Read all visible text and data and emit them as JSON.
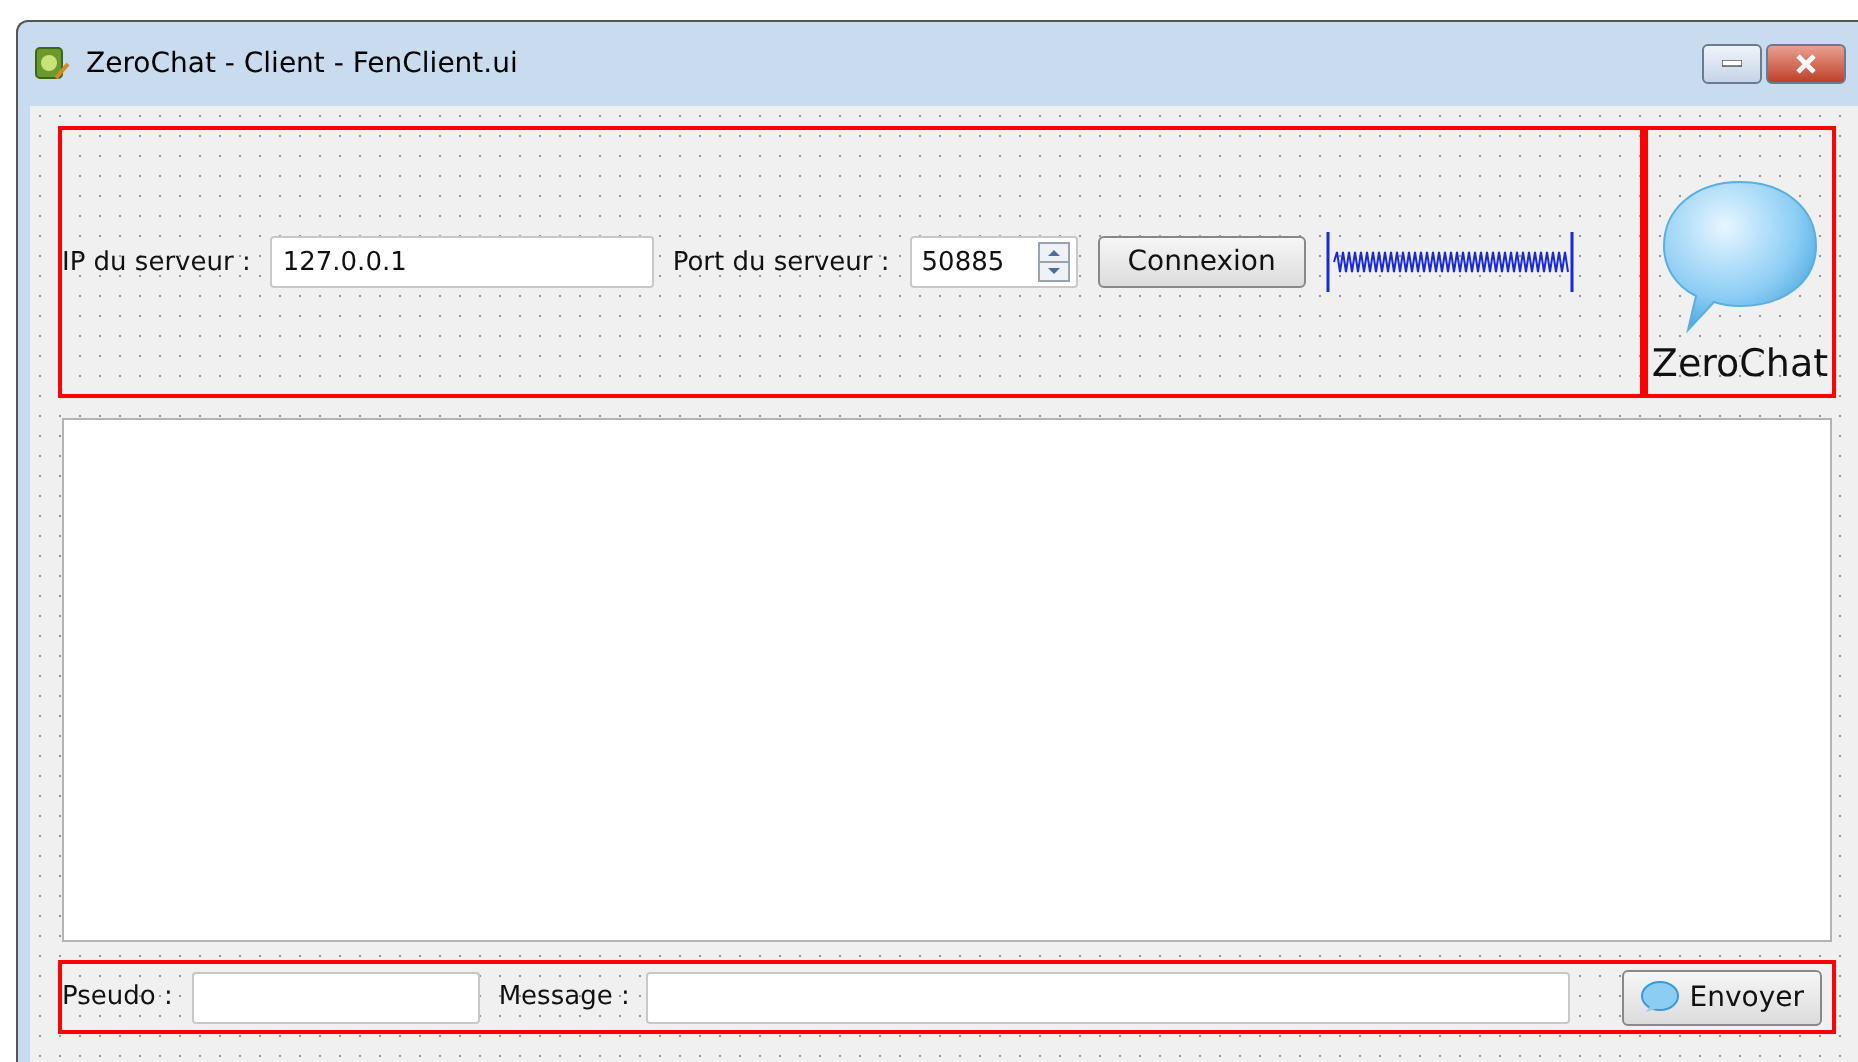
{
  "window": {
    "title": "ZeroChat - Client - FenClient.ui"
  },
  "connection": {
    "ip_label": "IP du serveur :",
    "ip_value": "127.0.0.1",
    "port_label": "Port du serveur :",
    "port_value": "50885",
    "connect_button": "Connexion"
  },
  "logo": {
    "label": "ZeroChat"
  },
  "bottom": {
    "pseudo_label": "Pseudo :",
    "message_label": "Message :",
    "send_button": "Envoyer"
  }
}
